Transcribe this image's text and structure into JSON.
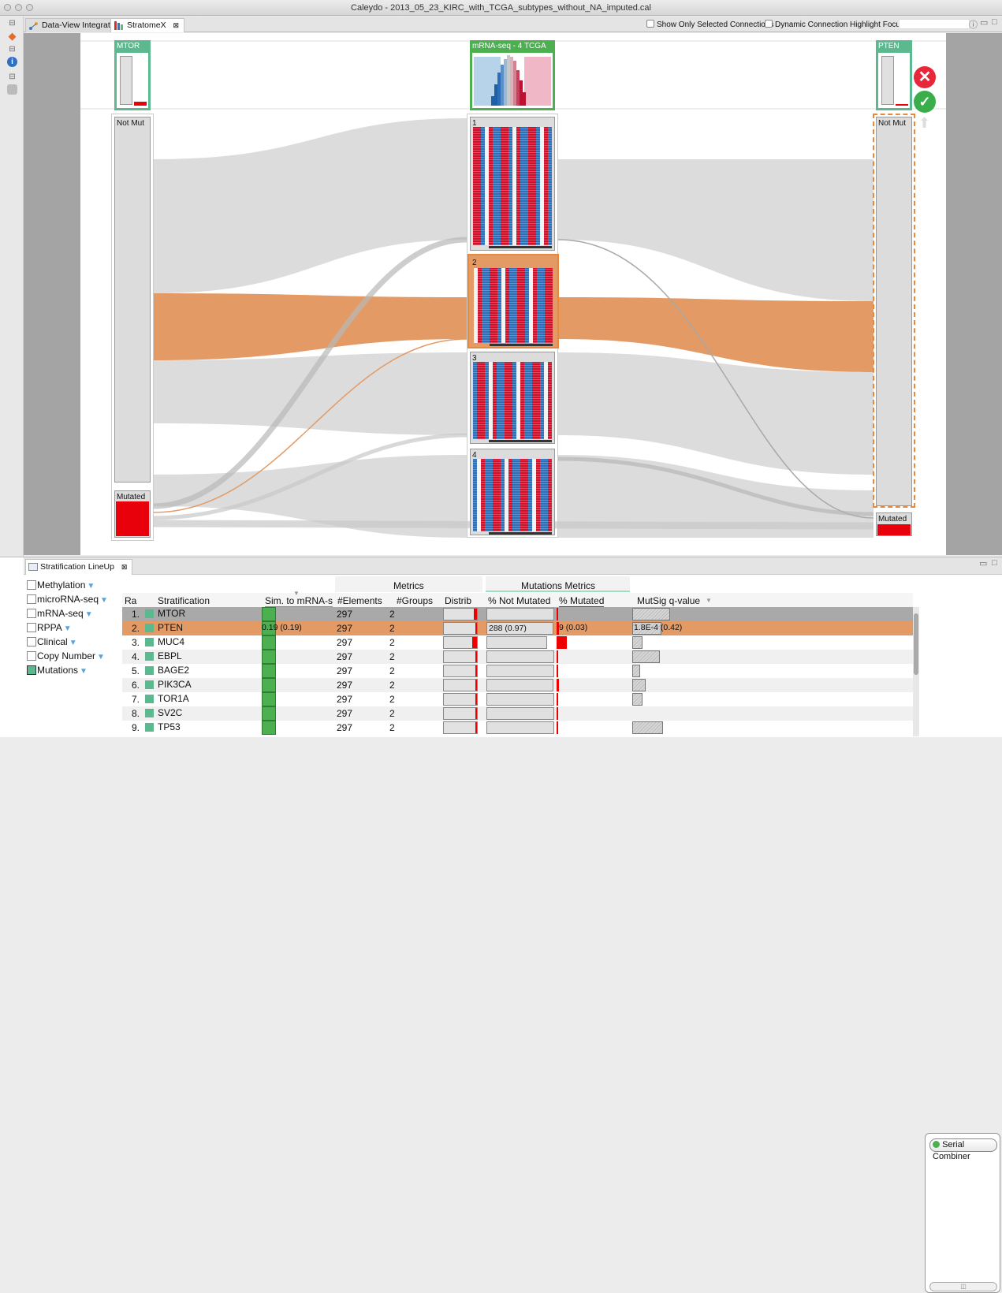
{
  "window": {
    "title": "Caleydo - 2013_05_23_KIRC_with_TCGA_subtypes_without_NA_imputed.cal"
  },
  "tabs": [
    {
      "label": "Data-View Integrator"
    },
    {
      "label": "StratomeX",
      "close": "⊠"
    }
  ],
  "toolbar": {
    "show_selected_label": "Show Only Selected Connections",
    "dynamic_highlight_label": "Dynamic Connection Highlight Focus"
  },
  "columns": {
    "left": {
      "title": "MTOR",
      "groups": [
        {
          "label": "Not Mut"
        },
        {
          "label": "Mutated"
        }
      ]
    },
    "center": {
      "title": "mRNA-seq - 4 TCGA",
      "groups": [
        {
          "label": "1"
        },
        {
          "label": "2"
        },
        {
          "label": "3"
        },
        {
          "label": "4"
        }
      ]
    },
    "right": {
      "title": "PTEN",
      "groups": [
        {
          "label": "Not Mut"
        },
        {
          "label": "Mutated"
        }
      ]
    }
  },
  "colors": {
    "selected": "#e39a64",
    "brick_title": "#5cb98f",
    "mutated": "#e8000b",
    "heat_red": "#d0102a",
    "heat_blue": "#2c6fb8"
  },
  "lineup": {
    "tab_label": "Stratification LineUp",
    "tab_close": "⊠",
    "datasets": [
      {
        "label": "Methylation",
        "checked": false
      },
      {
        "label": "microRNA-seq",
        "checked": false
      },
      {
        "label": "mRNA-seq",
        "checked": false
      },
      {
        "label": "RPPA",
        "checked": false
      },
      {
        "label": "Clinical",
        "checked": false
      },
      {
        "label": "Copy Number",
        "checked": false
      },
      {
        "label": "Mutations",
        "checked": true
      }
    ],
    "group_headers": {
      "metrics": "Metrics",
      "mutations": "Mutations Metrics"
    },
    "headers": {
      "rank": "Ra",
      "stratification": "Stratification",
      "sim": "Sim. to mRNA-s",
      "elements": "#Elements",
      "groups": "#Groups",
      "distrib": "Distrib",
      "not_mutated": "% Not Mutated",
      "mutated": "% Mutated",
      "mutsig": "MutSig q-value"
    },
    "rows": [
      {
        "rank": "1.",
        "name": "MTOR",
        "elements": "297",
        "groups": "2",
        "dist": 0.09,
        "notmut": 0.98,
        "mut": 0.02,
        "q": 0.55,
        "state": "hover"
      },
      {
        "rank": "2.",
        "name": "PTEN",
        "elements": "297",
        "groups": "2",
        "dist": 0.03,
        "notmut": 0.97,
        "mut": 0.03,
        "q": 0.42,
        "state": "selected",
        "sim_text": "0.19 (0.19)",
        "notmut_text": "288 (0.97)",
        "mut_text": "9 (0.03)",
        "q_text": "1.8E-4 (0.42)"
      },
      {
        "rank": "3.",
        "name": "MUC4",
        "elements": "297",
        "groups": "2",
        "dist": 0.13,
        "notmut": 0.87,
        "mut": 0.13,
        "q": 0.15
      },
      {
        "rank": "4.",
        "name": "EBPL",
        "elements": "297",
        "groups": "2",
        "dist": 0.02,
        "notmut": 0.98,
        "mut": 0.02,
        "q": 0.4
      },
      {
        "rank": "5.",
        "name": "BAGE2",
        "elements": "297",
        "groups": "2",
        "dist": 0.02,
        "notmut": 0.98,
        "mut": 0.02,
        "q": 0.12
      },
      {
        "rank": "6.",
        "name": "PIK3CA",
        "elements": "297",
        "groups": "2",
        "dist": 0.03,
        "notmut": 0.97,
        "mut": 0.03,
        "q": 0.2
      },
      {
        "rank": "7.",
        "name": "TOR1A",
        "elements": "297",
        "groups": "2",
        "dist": 0.02,
        "notmut": 0.98,
        "mut": 0.02,
        "q": 0.15
      },
      {
        "rank": "8.",
        "name": "SV2C",
        "elements": "297",
        "groups": "2",
        "dist": 0.02,
        "notmut": 0.98,
        "mut": 0.02,
        "q": 0
      },
      {
        "rank": "9.",
        "name": "TP53",
        "elements": "297",
        "groups": "2",
        "dist": 0.02,
        "notmut": 0.98,
        "mut": 0.02,
        "q": 0.45
      }
    ],
    "serial_combiner": "Serial Combiner"
  }
}
